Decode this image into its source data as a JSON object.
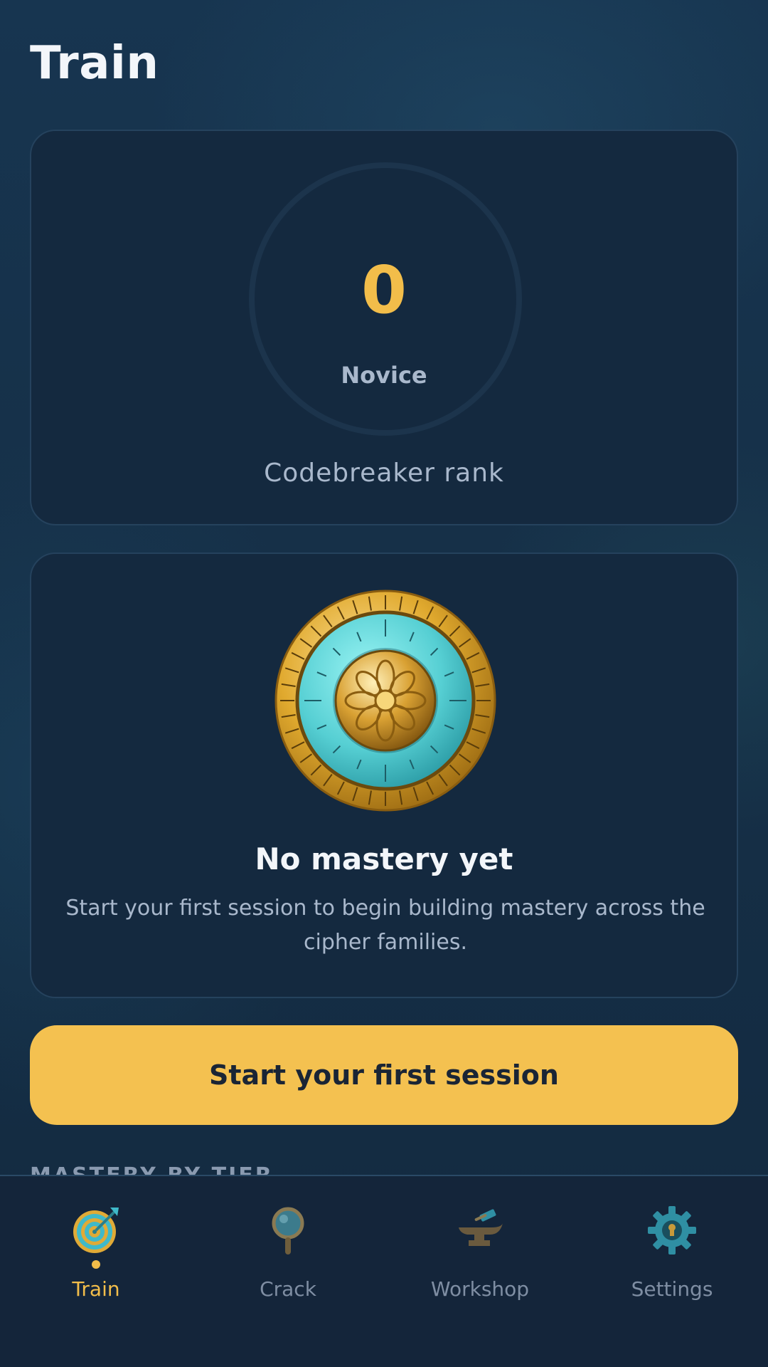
{
  "header": {
    "title": "Train"
  },
  "rank_card": {
    "value": "0",
    "tier": "Novice",
    "caption": "Codebreaker rank"
  },
  "mastery_card": {
    "title": "No mastery yet",
    "description": "Start your first session to begin building mastery across the cipher families."
  },
  "cta": {
    "label": "Start your first session"
  },
  "next_section": {
    "title": "MASTERY BY TIER"
  },
  "tabs": [
    {
      "label": "Train",
      "icon": "target-icon",
      "active": true
    },
    {
      "label": "Crack",
      "icon": "magnifier-icon",
      "active": false
    },
    {
      "label": "Workshop",
      "icon": "anvil-icon",
      "active": false
    },
    {
      "label": "Settings",
      "icon": "gear-lock-icon",
      "active": false
    }
  ],
  "colors": {
    "accent": "#f2bd4a",
    "card_bg": "#14293f",
    "muted_text": "#a9b8cc",
    "inactive_tab": "#7f8ea3"
  }
}
